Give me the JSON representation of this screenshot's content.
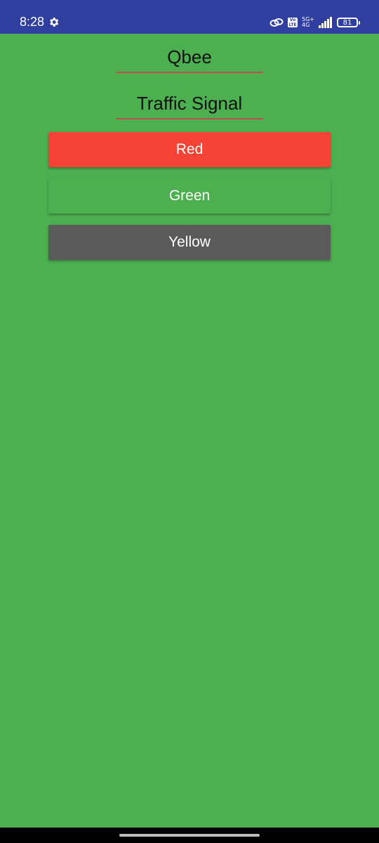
{
  "status_bar": {
    "time": "8:28",
    "network_top": "5G+",
    "network_bottom": "4G",
    "volte_top": "Vo",
    "volte_bottom": "LTE",
    "battery": "81",
    "background_color": "#303f9f"
  },
  "app": {
    "name": "Qbee",
    "title": "Traffic Signal",
    "background_color": "#4caf50"
  },
  "buttons": {
    "red_label": "Red",
    "green_label": "Green",
    "yellow_label": "Yellow",
    "red_color": "#f44336",
    "green_color": "#4caf50",
    "yellow_color": "#5a5a5a"
  }
}
